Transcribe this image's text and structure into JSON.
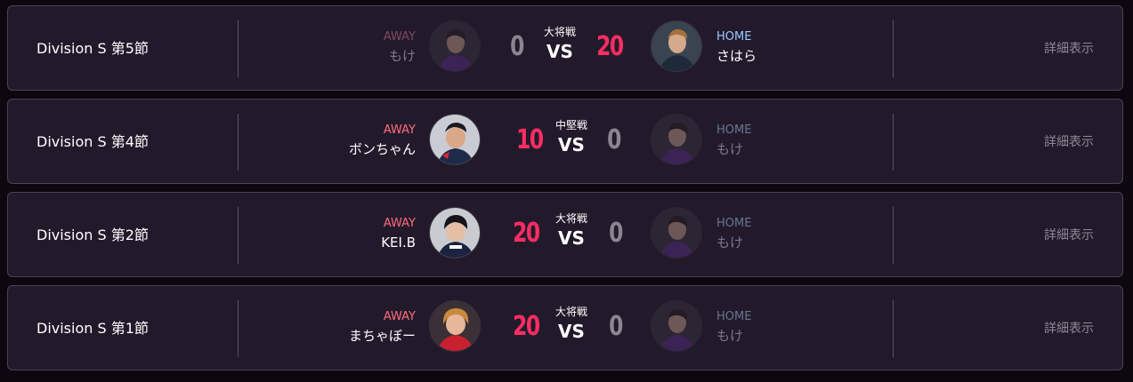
{
  "colors": {
    "page_bg": "#0d0710",
    "card_bg": "#221a2b",
    "win_score": "#ff2d63",
    "lose_score": "#8b8592",
    "away_label": "#ff6b7d",
    "home_label": "#9ec8ff"
  },
  "matches": [
    {
      "division": "Division S 第5節",
      "away": {
        "label": "AWAY",
        "name": "もけ",
        "score": "0",
        "result": "lose",
        "avatar_icon": "player-avatar-icon"
      },
      "rank": "大将戦",
      "vs": "VS",
      "home": {
        "label": "HOME",
        "name": "さはら",
        "score": "20",
        "result": "win",
        "avatar_icon": "player-avatar-icon"
      },
      "details_label": "詳細表示"
    },
    {
      "division": "Division S 第4節",
      "away": {
        "label": "AWAY",
        "name": "ボンちゃん",
        "score": "10",
        "result": "win",
        "avatar_icon": "player-avatar-icon"
      },
      "rank": "中堅戦",
      "vs": "VS",
      "home": {
        "label": "HOME",
        "name": "もけ",
        "score": "0",
        "result": "lose",
        "avatar_icon": "player-avatar-icon"
      },
      "details_label": "詳細表示"
    },
    {
      "division": "Division S 第2節",
      "away": {
        "label": "AWAY",
        "name": "KEI.B",
        "score": "20",
        "result": "win",
        "avatar_icon": "player-avatar-icon"
      },
      "rank": "大将戦",
      "vs": "VS",
      "home": {
        "label": "HOME",
        "name": "もけ",
        "score": "0",
        "result": "lose",
        "avatar_icon": "player-avatar-icon"
      },
      "details_label": "詳細表示"
    },
    {
      "division": "Division S 第1節",
      "away": {
        "label": "AWAY",
        "name": "まちゃぼー",
        "score": "20",
        "result": "win",
        "avatar_icon": "player-avatar-icon"
      },
      "rank": "大将戦",
      "vs": "VS",
      "home": {
        "label": "HOME",
        "name": "もけ",
        "score": "0",
        "result": "lose",
        "avatar_icon": "player-avatar-icon"
      },
      "details_label": "詳細表示"
    }
  ]
}
